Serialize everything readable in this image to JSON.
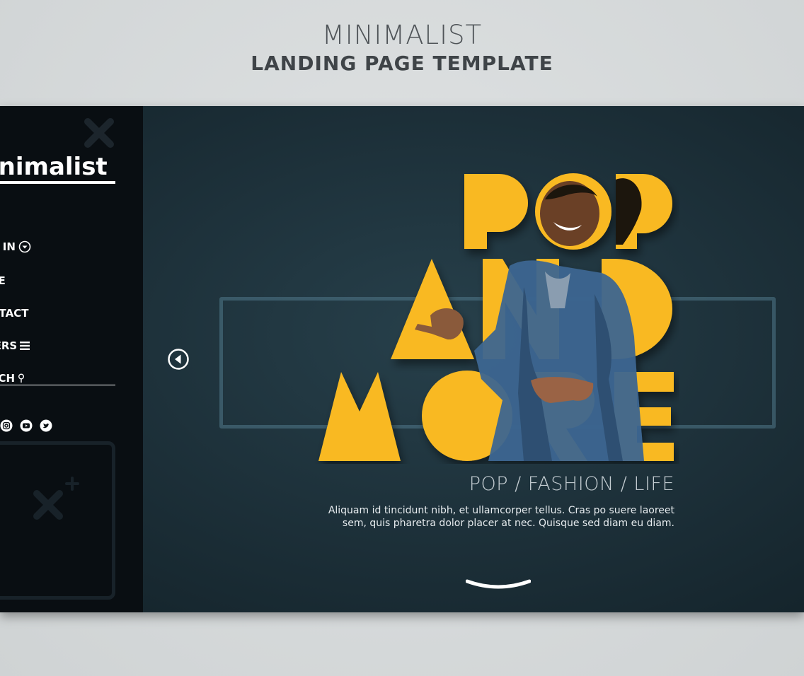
{
  "heading": {
    "title": "MINIMALIST",
    "subtitle": "LANDING PAGE TEMPLATE"
  },
  "sidebar": {
    "logo": "inimalist",
    "nav": [
      {
        "label": "N IN",
        "icon": "circle-chevron-down-icon"
      },
      {
        "label": "RE",
        "icon": ""
      },
      {
        "label": "NTACT",
        "icon": ""
      },
      {
        "label": "IERS",
        "icon": "hamburger-icon"
      },
      {
        "label": "RCH",
        "icon": "search-pin-icon"
      }
    ],
    "social_icons": [
      "instagram-icon",
      "youtube-icon",
      "twitter-icon"
    ]
  },
  "hero": {
    "headline_lines": [
      "POP",
      "AND",
      "MORE"
    ],
    "subtitle": "POP / FASHION / LIFE",
    "body": "Aliquam id tincidunt nibh, et ullamcorper tellus. Cras po suere laoreet sem, quis pharetra dolor placer at nec. Quisque sed diam eu diam."
  },
  "colors": {
    "accent": "#f9b921",
    "background": "#1c2f38",
    "sidebar": "#090e12",
    "denim": "#3d6690"
  }
}
